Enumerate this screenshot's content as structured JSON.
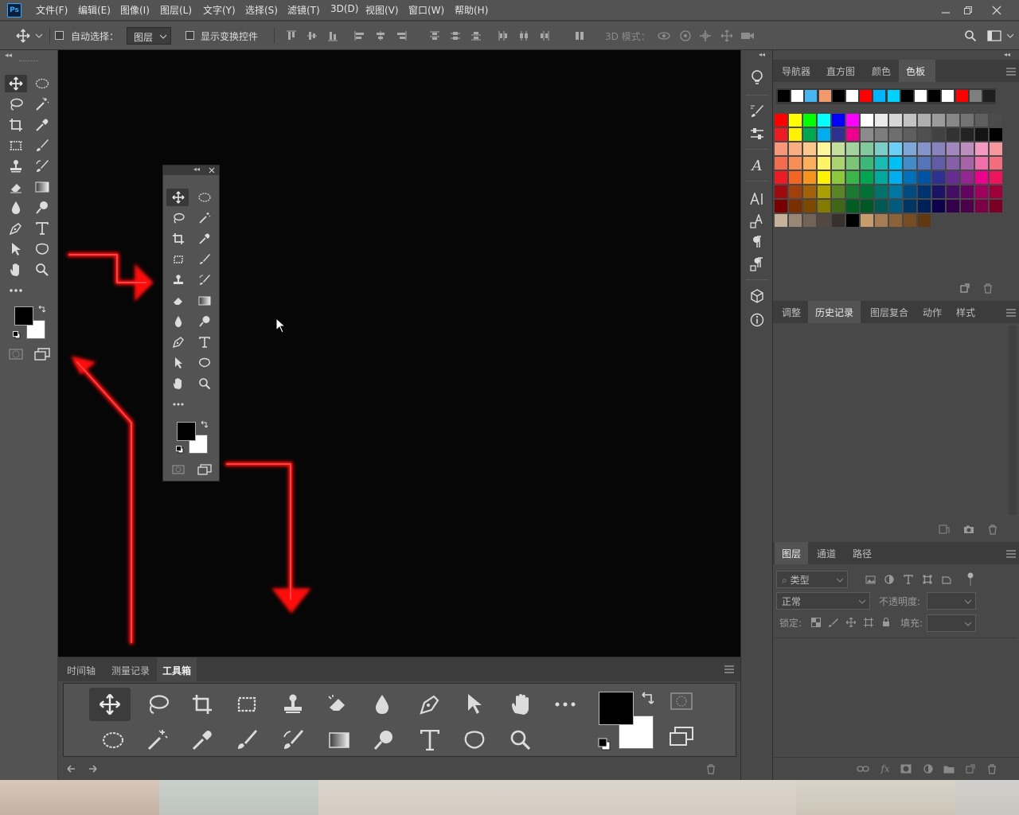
{
  "app": {
    "logo": "Ps",
    "menus": [
      "文件(F)",
      "编辑(E)",
      "图像(I)",
      "图层(L)",
      "文字(Y)",
      "选择(S)",
      "滤镜(T)",
      "3D(D)",
      "视图(V)",
      "窗口(W)",
      "帮助(H)"
    ]
  },
  "options": {
    "auto_select_label": "自动选择：",
    "auto_select_target": "图层",
    "show_transform_label": "显示变换控件",
    "mode_3d_label": "3D 模式："
  },
  "swatches_panel": {
    "tabs": [
      "导航器",
      "直方图",
      "颜色",
      "色板"
    ],
    "active_tab": "色板",
    "recent": [
      "#000000",
      "#ffffff",
      "#45b6f0",
      "#f29a6e",
      "#000000",
      "#ffffff",
      "#ff0000",
      "#00b4ff",
      "#00d2ff",
      "#000000",
      "#ffffff",
      "#000000",
      "#ffffff",
      "#ff0000",
      "#7f7f7f",
      "#1e1e1e"
    ],
    "rows": [
      [
        "#ff0000",
        "#ffff00",
        "#00ff00",
        "#00ffff",
        "#0000ff",
        "#ff00ff",
        "#ffffff",
        "#ebebeb",
        "#d7d7d7",
        "#c3c3c3",
        "#afafaf",
        "#9b9b9b",
        "#878787",
        "#737373",
        "#5f5f5f",
        "#4b4b4b"
      ],
      [
        "#ed1c24",
        "#fff200",
        "#00a651",
        "#00aeef",
        "#2e3192",
        "#ec008c",
        "#8c8c8c",
        "#7d7d7d",
        "#6e6e6e",
        "#5f5f5f",
        "#505050",
        "#414141",
        "#323232",
        "#232323",
        "#141414",
        "#000000"
      ],
      [
        "#f7977a",
        "#f9ad81",
        "#fdc68a",
        "#fff79a",
        "#c4df9b",
        "#a2d39c",
        "#82ca9d",
        "#7bcdc8",
        "#6ecff6",
        "#7ea7d8",
        "#8493ca",
        "#8882be",
        "#a187be",
        "#bc8dbf",
        "#f49ac2",
        "#f6989d"
      ],
      [
        "#f26c4f",
        "#f68e55",
        "#fbaf5c",
        "#fff467",
        "#acd372",
        "#7cc576",
        "#3bb878",
        "#1abbb4",
        "#00bff3",
        "#438cca",
        "#5574b9",
        "#605ca8",
        "#855fa8",
        "#a763a8",
        "#f06ea9",
        "#f26d7d"
      ],
      [
        "#ed1c24",
        "#f26522",
        "#f7941d",
        "#fff200",
        "#8dc73f",
        "#39b54a",
        "#00a651",
        "#00a99d",
        "#00aeef",
        "#0072bc",
        "#0054a6",
        "#2e3192",
        "#662d91",
        "#92278f",
        "#ec008c",
        "#ed145b"
      ],
      [
        "#9e0b0f",
        "#a0410d",
        "#a36209",
        "#aba000",
        "#598527",
        "#1a7b30",
        "#007236",
        "#00746b",
        "#0076a3",
        "#004b80",
        "#003471",
        "#1b1464",
        "#440e62",
        "#630460",
        "#9e005d",
        "#9e0039"
      ],
      [
        "#790000",
        "#7b2e00",
        "#7d4900",
        "#827b00",
        "#406618",
        "#005e20",
        "#005826",
        "#005952",
        "#005b7f",
        "#003663",
        "#002157",
        "#0d004c",
        "#32004b",
        "#4b0049",
        "#7b0046",
        "#7a0026"
      ],
      [
        "#c7b299",
        "#998675",
        "#736357",
        "#534741",
        "#37302d",
        "#000000",
        "#c69c6d",
        "#a67c52",
        "#8c6239",
        "#754c24",
        "#603913"
      ]
    ]
  },
  "history_panel": {
    "tabs": [
      "调整",
      "历史记录",
      "图层复合",
      "动作",
      "样式"
    ],
    "active_tab": "历史记录"
  },
  "layers_panel": {
    "tabs": [
      "图层",
      "通道",
      "路径"
    ],
    "active_tab": "图层",
    "filter_placeholder": "类型",
    "blend_mode": "正常",
    "opacity_label": "不透明度:",
    "lock_label": "锁定:",
    "fill_label": "填充:"
  },
  "bottom_panel": {
    "tabs": [
      "时间轴",
      "测量记录",
      "工具箱"
    ],
    "active_tab": "工具箱"
  },
  "colors": {
    "chrome": "#535353",
    "panel": "#484848",
    "canvas": "#060606",
    "arrow_red": "#ff1010"
  },
  "icons": {
    "tools": [
      "move-tool-icon",
      "marquee-tool-icon",
      "lasso-tool-icon",
      "magic-wand-icon",
      "crop-tool-icon",
      "eyedropper-icon",
      "frame-tool-icon",
      "brush-tool-icon",
      "stamp-tool-icon",
      "history-brush-icon",
      "eraser-tool-icon",
      "gradient-tool-icon",
      "blur-tool-icon",
      "dodge-tool-icon",
      "pen-tool-icon",
      "type-tool-icon",
      "path-select-icon",
      "shape-tool-icon",
      "hand-tool-icon",
      "zoom-tool-icon"
    ]
  }
}
